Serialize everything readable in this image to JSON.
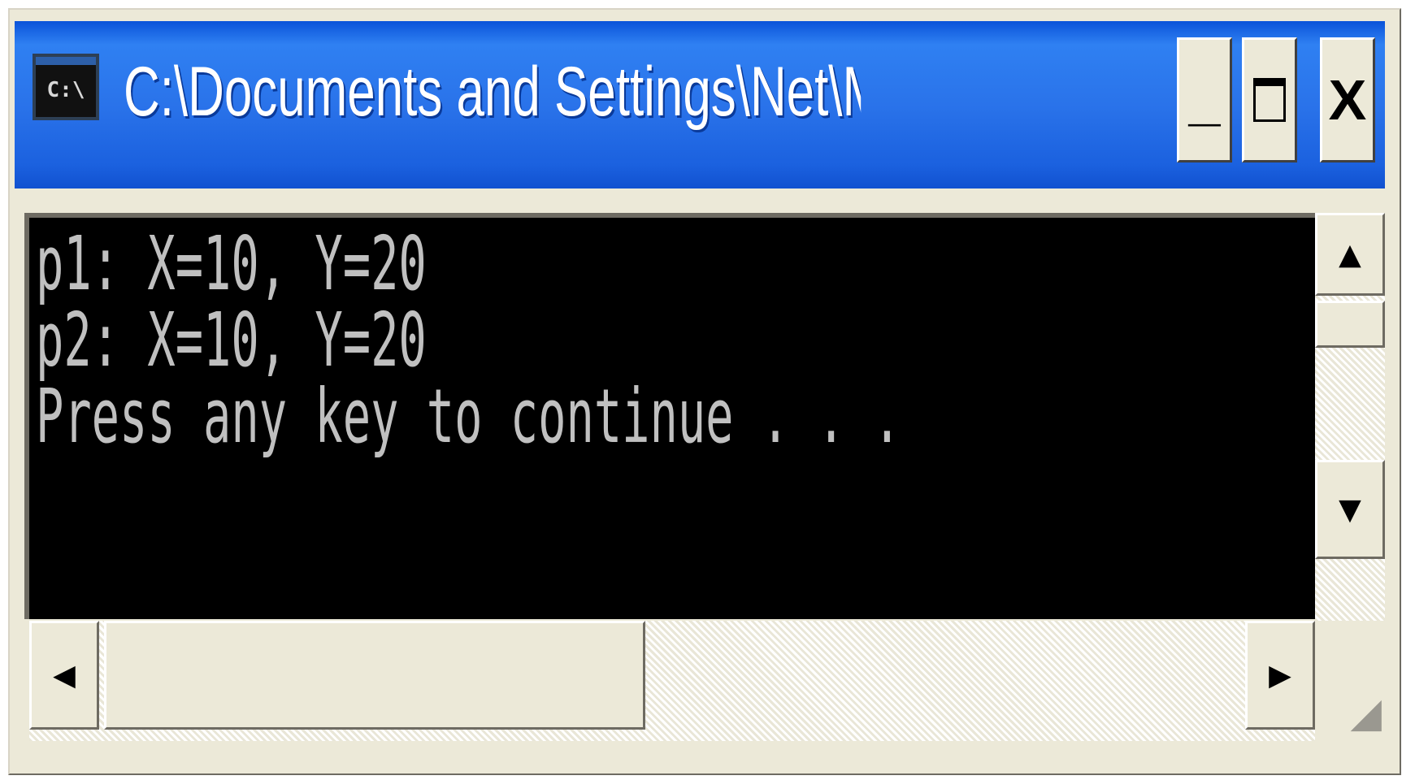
{
  "window": {
    "title": "C:\\Documents and Settings\\Net\\My D...",
    "icon_label": "C:\\",
    "controls": {
      "minimize": "_",
      "close": "X"
    }
  },
  "console": {
    "lines": [
      "p1: X=10, Y=20",
      "p2: X=10, Y=20",
      "Press any key to continue . . ."
    ]
  },
  "scrollbars": {
    "vertical": {
      "up_arrow": "▲",
      "down_arrow": "▼"
    },
    "horizontal": {
      "left_arrow": "◀",
      "right_arrow": "▶"
    }
  },
  "colors": {
    "titlebar": "#2a73ea",
    "console_bg": "#000000",
    "console_text": "#c0c0c0",
    "chrome": "#ece9d8"
  }
}
